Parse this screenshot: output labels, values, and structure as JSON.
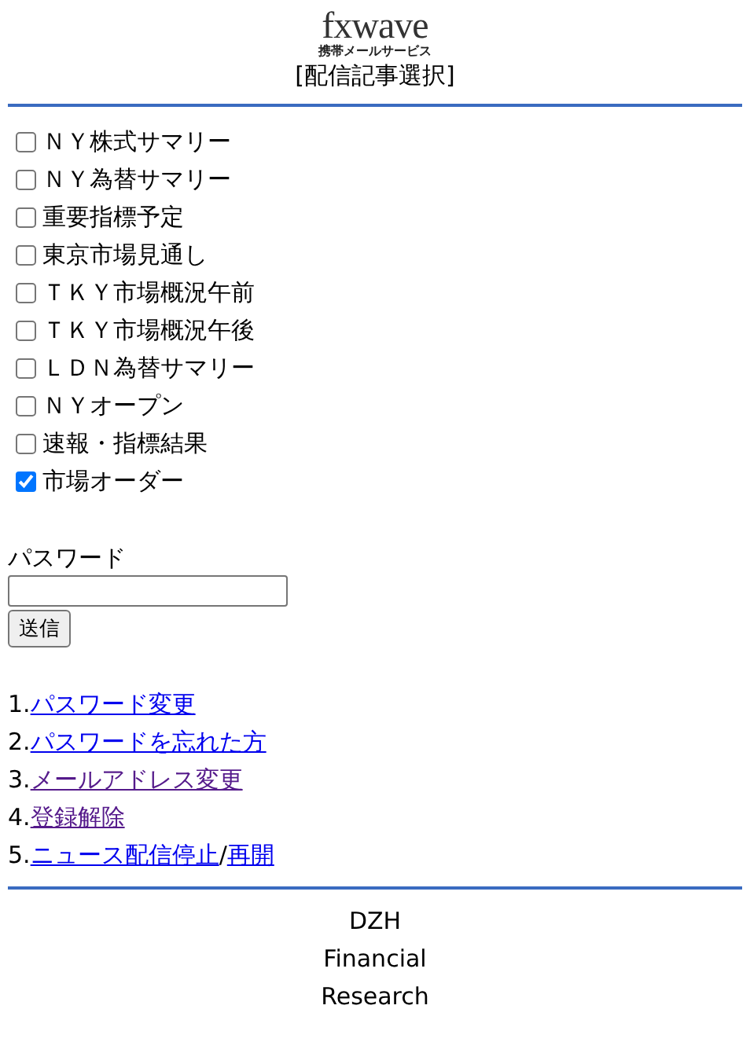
{
  "logo": {
    "wordmark": "fxwave",
    "tagline": "携帯メールサービス"
  },
  "heading": "[配信記事選択]",
  "articles": [
    {
      "label": "ＮＹ株式サマリー",
      "checked": false
    },
    {
      "label": "ＮＹ為替サマリー",
      "checked": false
    },
    {
      "label": "重要指標予定",
      "checked": false
    },
    {
      "label": "東京市場見通し",
      "checked": false
    },
    {
      "label": "ＴＫＹ市場概況午前",
      "checked": false
    },
    {
      "label": "ＴＫＹ市場概況午後",
      "checked": false
    },
    {
      "label": "ＬＤＮ為替サマリー",
      "checked": false
    },
    {
      "label": "ＮＹオープン",
      "checked": false
    },
    {
      "label": "速報・指標結果",
      "checked": false
    },
    {
      "label": "市場オーダー",
      "checked": true
    }
  ],
  "password": {
    "label": "パスワード",
    "button": "送信"
  },
  "menu": [
    {
      "number": "1.",
      "links": [
        {
          "text": "パスワード変更",
          "visited": false
        }
      ]
    },
    {
      "number": "2.",
      "links": [
        {
          "text": "パスワードを忘れた方",
          "visited": false
        }
      ]
    },
    {
      "number": "3.",
      "links": [
        {
          "text": "メールアドレス変更",
          "visited": true
        }
      ]
    },
    {
      "number": "4.",
      "links": [
        {
          "text": "登録解除",
          "visited": true
        }
      ]
    },
    {
      "number": "5.",
      "links": [
        {
          "text": "ニュース配信停止",
          "visited": false
        },
        {
          "text": "再開",
          "visited": false
        }
      ],
      "separator": "/"
    }
  ],
  "footer": [
    "DZH",
    "Financial",
    "Research"
  ]
}
